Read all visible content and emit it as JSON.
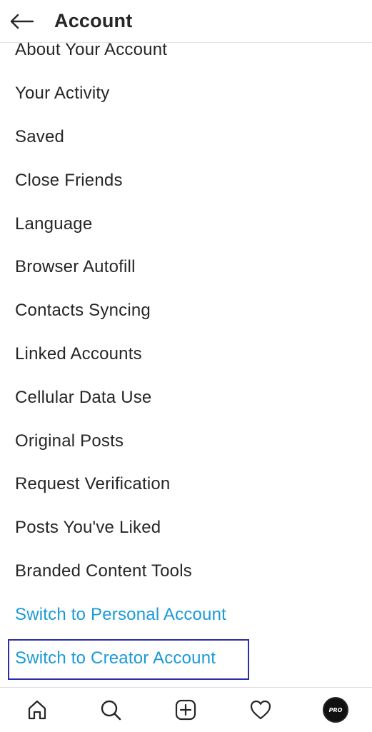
{
  "header": {
    "title": "Account",
    "back_icon": "arrow-left-icon"
  },
  "menu": {
    "items": [
      {
        "label": "About Your Account"
      },
      {
        "label": "Your Activity"
      },
      {
        "label": "Saved"
      },
      {
        "label": "Close Friends"
      },
      {
        "label": "Language"
      },
      {
        "label": "Browser Autofill"
      },
      {
        "label": "Contacts Syncing"
      },
      {
        "label": "Linked Accounts"
      },
      {
        "label": "Cellular Data Use"
      },
      {
        "label": "Original Posts"
      },
      {
        "label": "Request Verification"
      },
      {
        "label": "Posts You've Liked"
      },
      {
        "label": "Branded Content Tools"
      },
      {
        "label": "Switch to Personal Account"
      },
      {
        "label": "Switch to Creator Account"
      }
    ],
    "link_color": "#1a9ad6",
    "highlight_color": "#2a2ea8"
  },
  "tabbar": {
    "icons": [
      "home-icon",
      "search-icon",
      "add-post-icon",
      "heart-icon",
      "profile-avatar"
    ],
    "avatar_text": "PRO"
  }
}
